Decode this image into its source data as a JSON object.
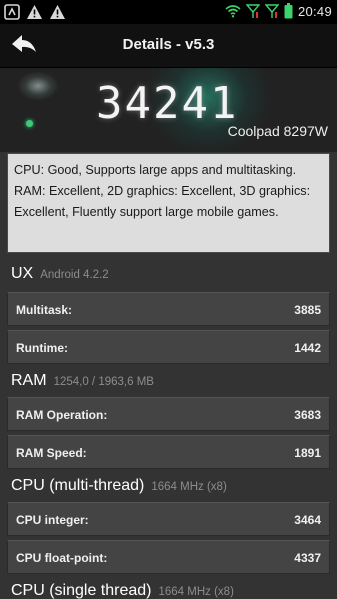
{
  "status_bar": {
    "time": "20:49",
    "left_icons": [
      "usb-debug-icon",
      "warning-icon",
      "warning-icon"
    ],
    "right_icons": [
      "wifi-icon",
      "signal-icon",
      "signal-icon",
      "battery-icon"
    ]
  },
  "action_bar": {
    "title": "Details - v5.3",
    "back_icon": "back-arrow-icon"
  },
  "hero": {
    "score": "34241",
    "device": "Coolpad 8297W"
  },
  "description": "CPU: Good, Supports large apps and multitasking. RAM: Excellent, 2D graphics: Excellent, 3D graphics: Excellent, Fluently support large mobile games.",
  "sections": {
    "ux": {
      "title": "UX",
      "subtitle": "Android 4.2.2",
      "rows": [
        {
          "label": "Multitask:",
          "value": "3885"
        },
        {
          "label": "Runtime:",
          "value": "1442"
        }
      ]
    },
    "ram": {
      "title": "RAM",
      "subtitle": "1254,0 / 1963,6 MB",
      "rows": [
        {
          "label": "RAM Operation:",
          "value": "3683"
        },
        {
          "label": "RAM Speed:",
          "value": "1891"
        }
      ]
    },
    "cpu_multi": {
      "title": "CPU (multi-thread)",
      "subtitle": "1664 MHz (x8)",
      "rows": [
        {
          "label": "CPU integer:",
          "value": "3464"
        },
        {
          "label": "CPU float-point:",
          "value": "4337"
        }
      ]
    },
    "cpu_single": {
      "title": "CPU (single thread)",
      "subtitle": "1664 MHz (x8)"
    }
  },
  "colors": {
    "background": "#333333",
    "row_background": "#444444",
    "description_background": "#dddddd",
    "accent_green": "#40c878"
  }
}
